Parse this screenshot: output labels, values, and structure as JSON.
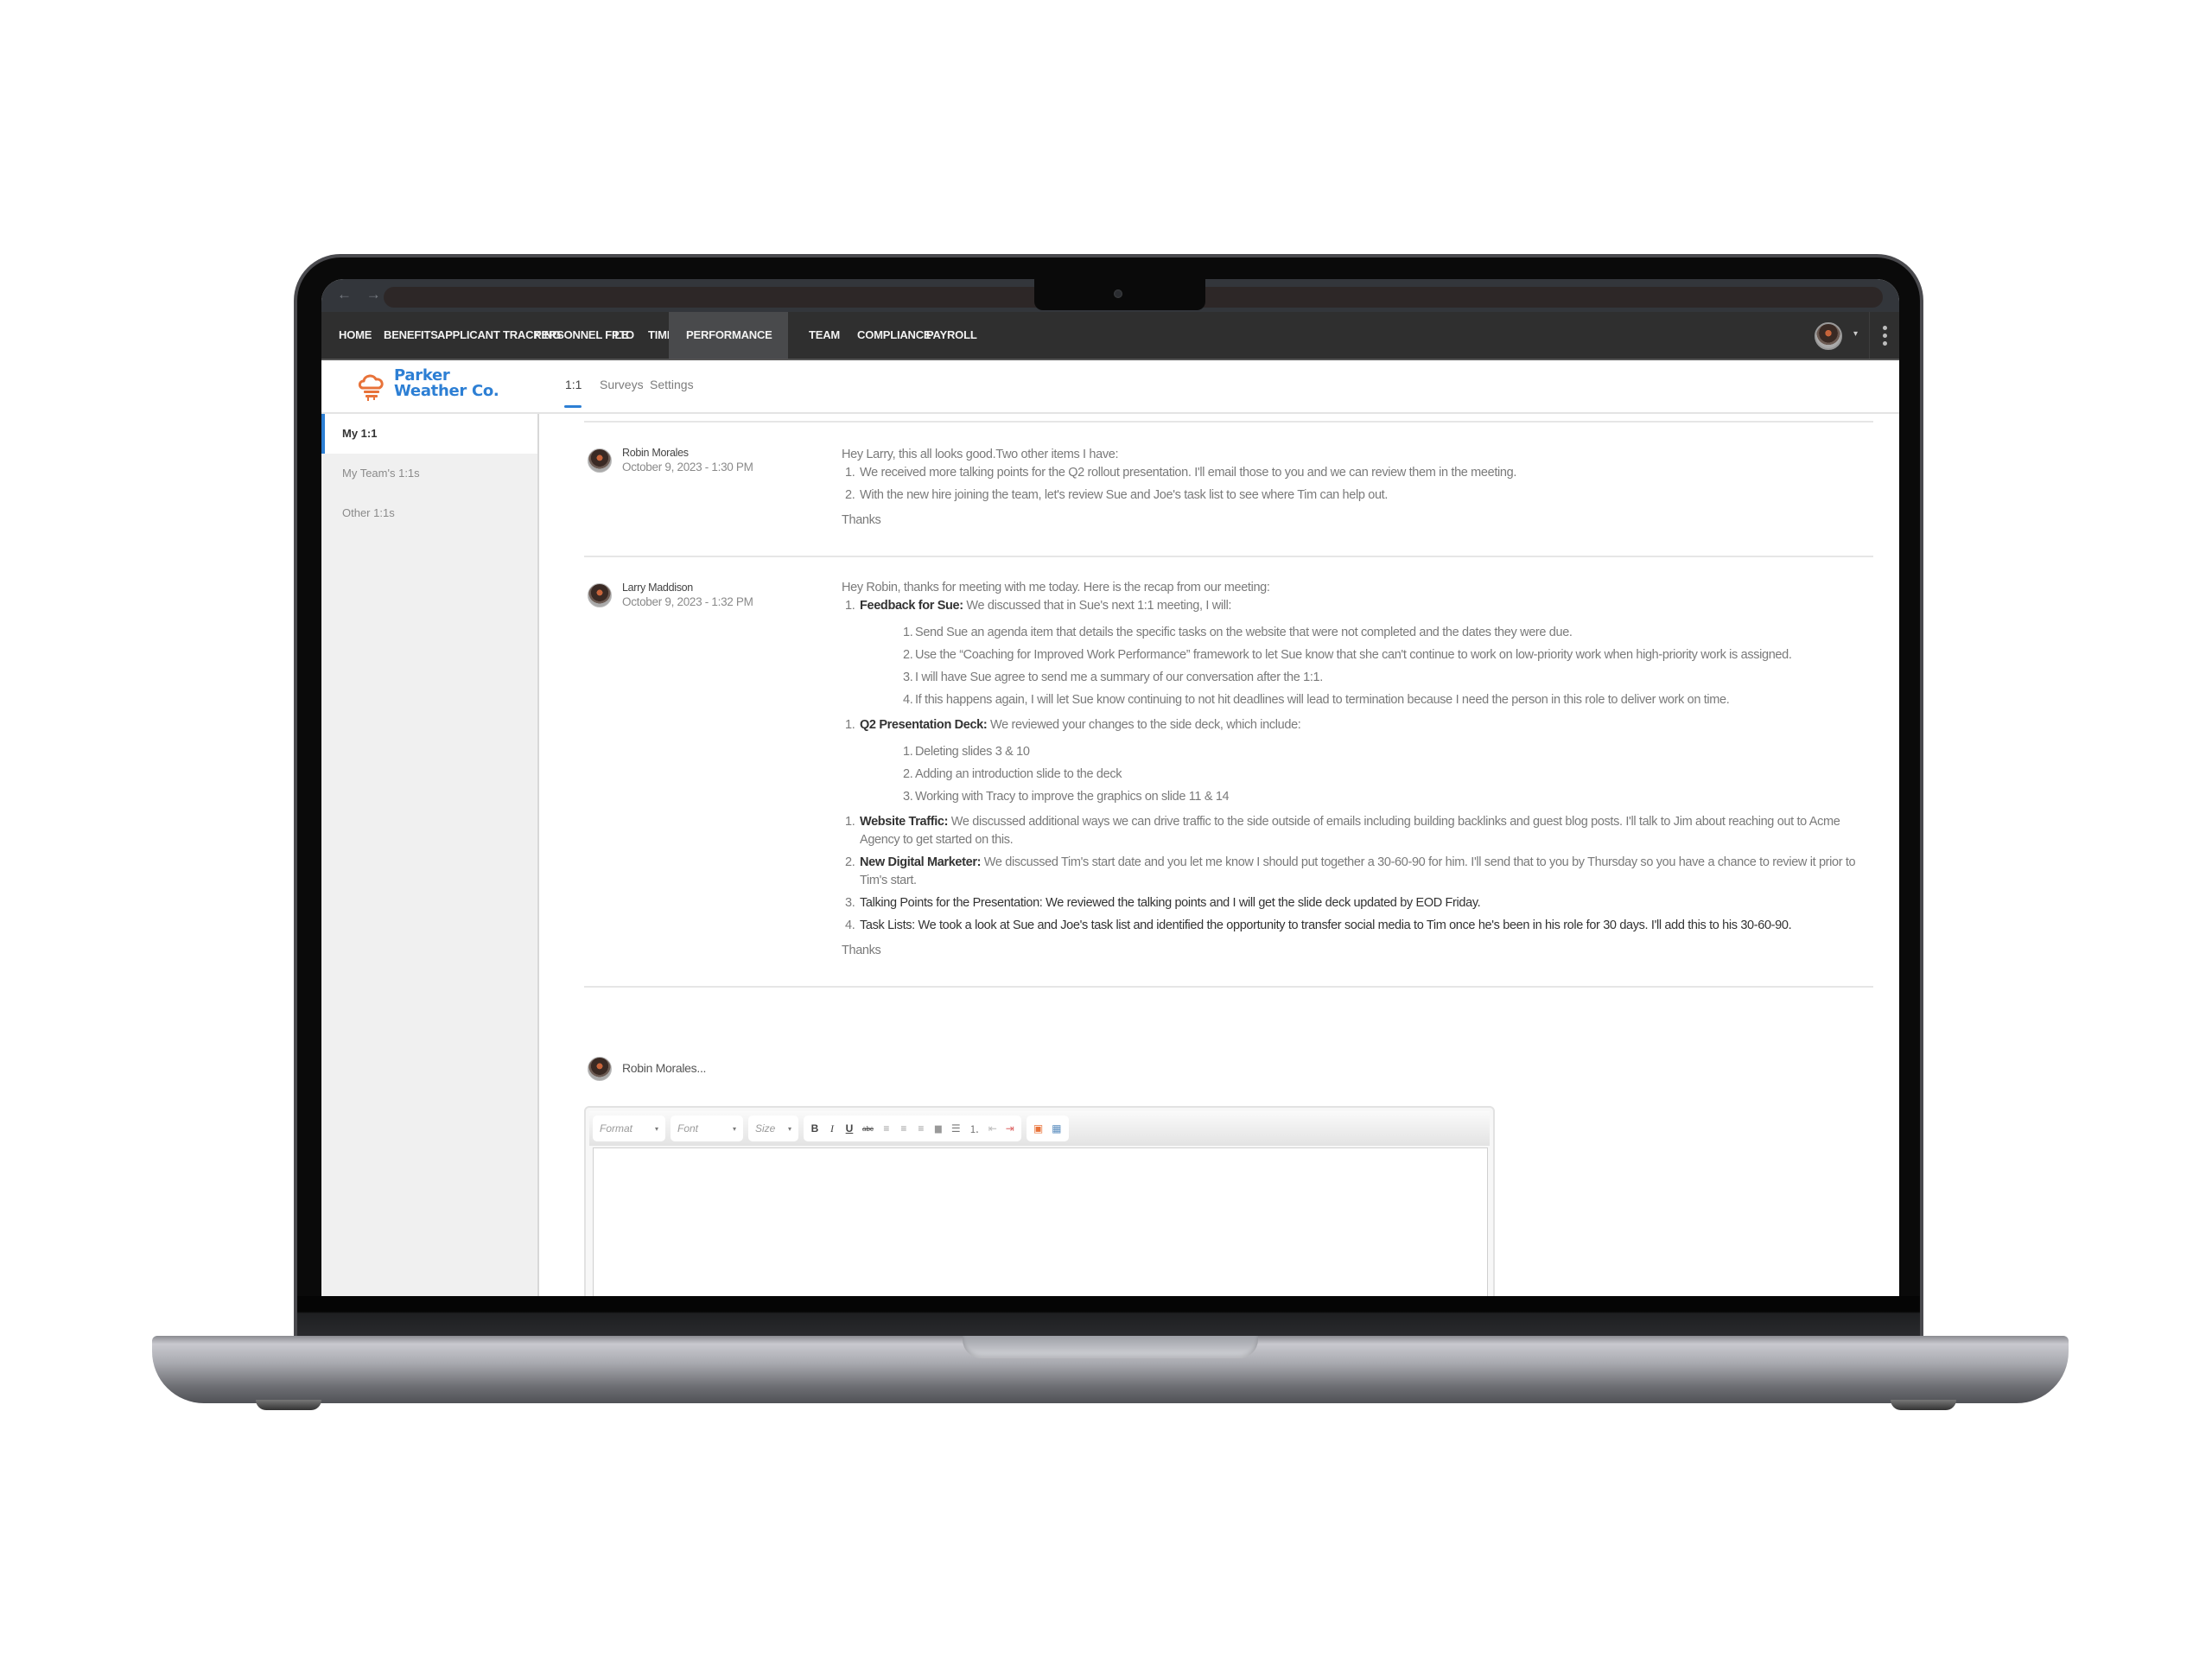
{
  "browser": {
    "nav_arrows": "← →"
  },
  "topnav": {
    "items": [
      {
        "label": "HOME"
      },
      {
        "label": "BENEFITS"
      },
      {
        "label": "APPLICANT TRACKING"
      },
      {
        "label": "PERSONNEL FILE"
      },
      {
        "label": "PTO"
      },
      {
        "label": "TIME"
      },
      {
        "label": "PERFORMANCE",
        "active": true
      },
      {
        "label": "TEAM"
      },
      {
        "label": "COMPLIANCE"
      },
      {
        "label": "PAYROLL"
      }
    ],
    "user_caret": "▾"
  },
  "brand": {
    "line1": "Parker",
    "line2": "Weather Co.",
    "color": "#2d7fd4",
    "icon_color": "#e8733a"
  },
  "tabs": [
    {
      "label": "1:1",
      "active": true
    },
    {
      "label": "Surveys"
    },
    {
      "label": "Settings"
    }
  ],
  "sidebar": {
    "items": [
      {
        "label": "My 1:1",
        "active": true
      },
      {
        "label": "My Team's 1:1s"
      },
      {
        "label": "Other 1:1s"
      }
    ]
  },
  "messages": [
    {
      "author": "Robin Morales",
      "date": "October 9, 2023 - 1:30 PM",
      "intro": "Hey Larry, this all looks good.Two other items I have:",
      "items": [
        {
          "num": "1.",
          "text": "We received more talking points for the Q2 rollout presentation. I'll email those to you and we can review them in the meeting."
        },
        {
          "num": "2.",
          "text": "With the new hire joining the team, let's review Sue and Joe's task list to see where Tim can help out."
        }
      ],
      "closing": "Thanks"
    },
    {
      "author": "Larry Maddison",
      "date": "October 9, 2023 - 1:32 PM",
      "intro": "Hey Robin, thanks for meeting with me today. Here is the recap from our meeting:",
      "sections": [
        {
          "num": "1.",
          "title": "Feedback for Sue:",
          "text": " We discussed that in Sue's next 1:1 meeting, I will:",
          "subitems": [
            {
              "num": "1.",
              "text": "Send Sue an agenda item that details the specific tasks on the website that were not completed and the dates they were due."
            },
            {
              "num": "2.",
              "text": "Use the “Coaching for Improved Work Performance” framework to let Sue know that she can't continue to work on low-priority work when high-priority work is assigned."
            },
            {
              "num": "3.",
              "text": "I will have Sue agree to send me a summary of our conversation after the 1:1."
            },
            {
              "num": "4.",
              "text": "If this happens again, I will let Sue know continuing to not hit deadlines will lead to termination because I need the person in this role to deliver work on time."
            }
          ]
        },
        {
          "num": "1.",
          "title": "Q2 Presentation Deck:",
          "text": " We reviewed your changes to the side deck, which include:",
          "subitems": [
            {
              "num": "1.",
              "text": "Deleting slides 3 & 10"
            },
            {
              "num": "2.",
              "text": "Adding an introduction slide to the deck"
            },
            {
              "num": "3.",
              "text": "Working with Tracy to improve the graphics on slide 11 & 14"
            }
          ]
        }
      ],
      "items": [
        {
          "num": "1.",
          "title": "Website Traffic:",
          "text": " We discussed additional ways we can drive traffic to the side outside of emails including building backlinks and guest blog posts. I'll talk to Jim about reaching out to Acme Agency to get started on this."
        },
        {
          "num": "2.",
          "title": "New Digital Marketer:",
          "text": " We discussed Tim's start date and you let me know I should put together a 30-60-90 for him. I'll send that to you by Thursday so you have a chance to review it prior to Tim's start."
        },
        {
          "num": "3.",
          "title": "Talking Points for the Presentation:",
          "text": " We reviewed the talking points and I will get the slide deck updated by EOD Friday."
        },
        {
          "num": "4.",
          "title": "Task Lists:",
          "text": " We took a look at Sue and Joe's task list and identified the opportunity to transfer social media to Tim once he's been in his role for 30 days. I'll add this to his 30-60-90."
        }
      ],
      "closing": "Thanks"
    }
  ],
  "composer": {
    "author": "Robin Morales...",
    "toolbar": {
      "format_placeholder": "Format",
      "font_placeholder": "Font",
      "size_placeholder": "Size",
      "caret": "▾",
      "buttons": {
        "bold": "B",
        "italic": "I",
        "underline": "U",
        "strike": "abc",
        "align_left": "≡",
        "align_center": "≡",
        "align_right": "≡",
        "justify": "▆",
        "bullet_list": "☰",
        "numbered_list": "⒈",
        "outdent": "⇤",
        "indent": "⇥",
        "paste_word": "▣",
        "insert_table": "▦"
      }
    },
    "value": ""
  }
}
